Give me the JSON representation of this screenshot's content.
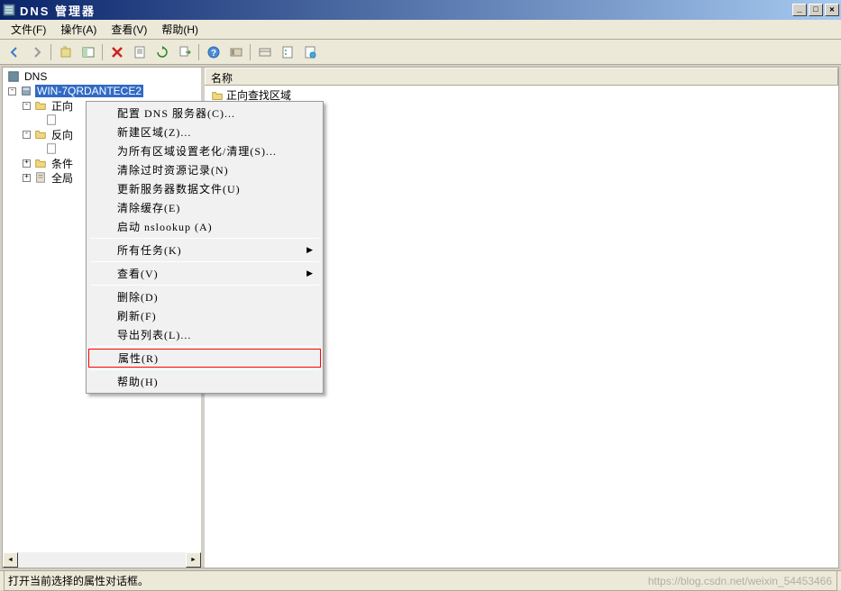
{
  "window": {
    "title": "DNS 管理器"
  },
  "menubar": {
    "file": "文件(F)",
    "action": "操作(A)",
    "view": "查看(V)",
    "help": "帮助(H)"
  },
  "tree": {
    "root": "DNS",
    "server": "WIN-7QRDANTECE2",
    "forward": "正向",
    "reverse": "反向",
    "conditional": "条件",
    "global": "全局"
  },
  "list": {
    "header_name": "名称",
    "item1": "正向查找区域"
  },
  "context_menu": {
    "configure_dns": "配置 DNS 服务器(C)...",
    "new_zone": "新建区域(Z)...",
    "set_aging": "为所有区域设置老化/清理(S)...",
    "scavenge": "清除过时资源记录(N)",
    "update_files": "更新服务器数据文件(U)",
    "clear_cache": "清除缓存(E)",
    "launch_nslookup": "启动 nslookup (A)",
    "all_tasks": "所有任务(K)",
    "view": "查看(V)",
    "delete": "删除(D)",
    "refresh": "刷新(F)",
    "export_list": "导出列表(L)...",
    "properties": "属性(R)",
    "help": "帮助(H)"
  },
  "statusbar": {
    "text": "打开当前选择的属性对话框。"
  },
  "watermark": "https://blog.csdn.net/weixin_54453466"
}
